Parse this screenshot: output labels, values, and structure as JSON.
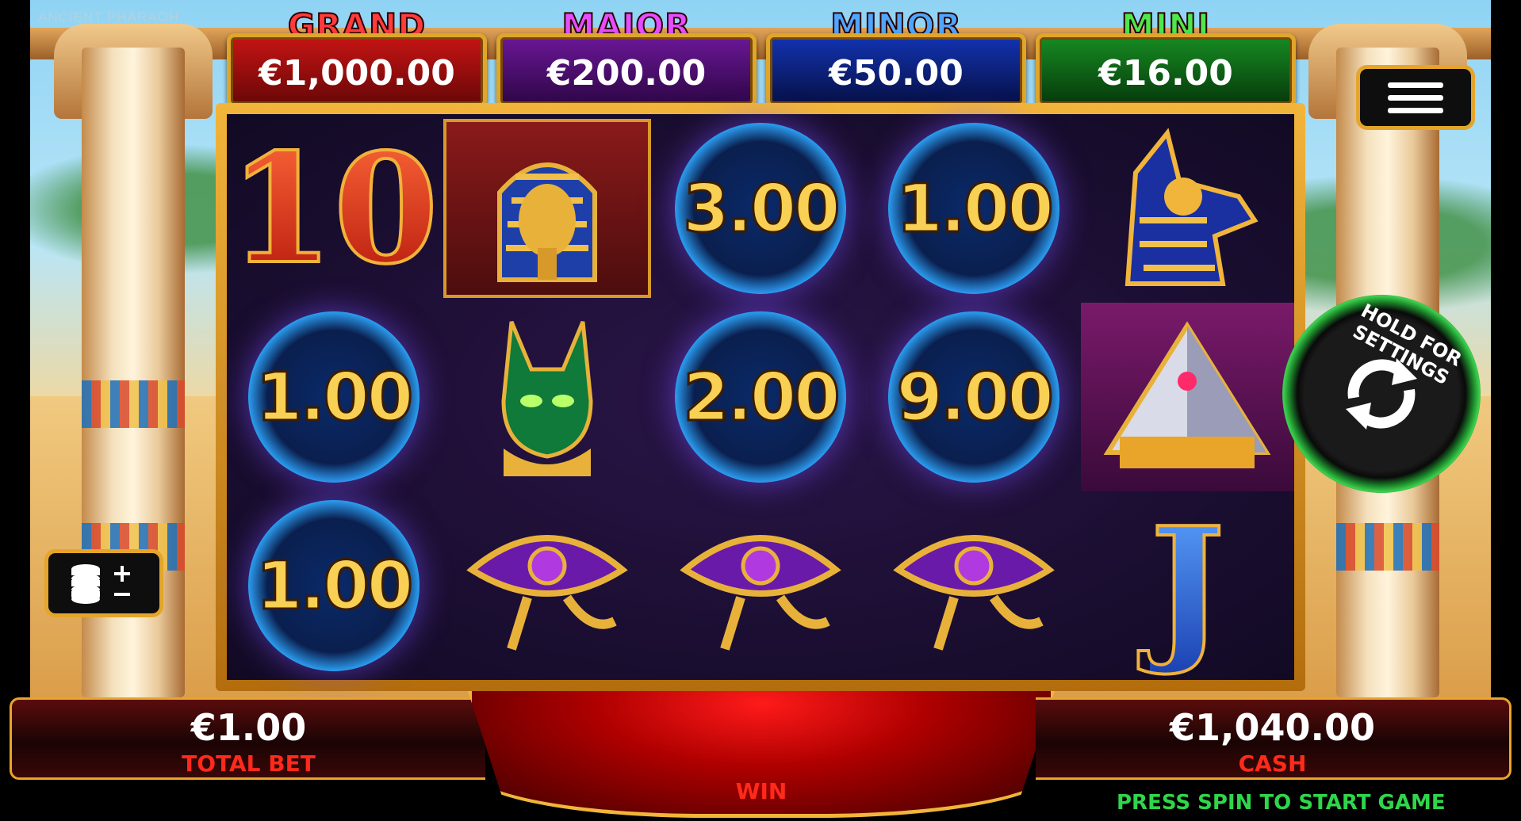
{
  "game": {
    "title": "ANCIENT PHARAOH"
  },
  "jackpots": [
    {
      "name": "GRAND",
      "value": "€1,000.00",
      "label_color": "#ff3b3b",
      "box_color": "#a10c0c"
    },
    {
      "name": "MAJOR",
      "value": "€200.00",
      "label_color": "#e64dff",
      "box_color": "#4b0d6e"
    },
    {
      "name": "MINOR",
      "value": "€50.00",
      "label_color": "#4fa6ff",
      "box_color": "#0a1e7a"
    },
    {
      "name": "MINI",
      "value": "€16.00",
      "label_color": "#4ce84c",
      "box_color": "#0d5a14"
    }
  ],
  "reels": [
    [
      "10",
      "pharaoh-mask",
      "3.00",
      "1.00",
      "anubis"
    ],
    [
      "1.00",
      "cat-bastet",
      "2.00",
      "9.00",
      "pyramid"
    ],
    [
      "1.00",
      "eye-of-horus",
      "eye-of-horus",
      "eye-of-horus",
      "J"
    ]
  ],
  "controls": {
    "menu_icon": "hamburger-menu-icon",
    "spin_hint": "HOLD FOR SETTINGS",
    "spin_icon": "spin-arrows-icon",
    "bet_icon": "coins-plus-minus-icon"
  },
  "bottom": {
    "total_bet_value": "€1.00",
    "total_bet_label": "TOTAL BET",
    "win_label": "WIN",
    "cash_value": "€1,040.00",
    "cash_label": "CASH",
    "status_message": "PRESS SPIN TO START GAME"
  },
  "colors": {
    "accent_gold": "#e4a52a",
    "status_green": "#2fd64a",
    "label_red": "#ff2a1a",
    "orb_value_gold": "#f7d054"
  }
}
